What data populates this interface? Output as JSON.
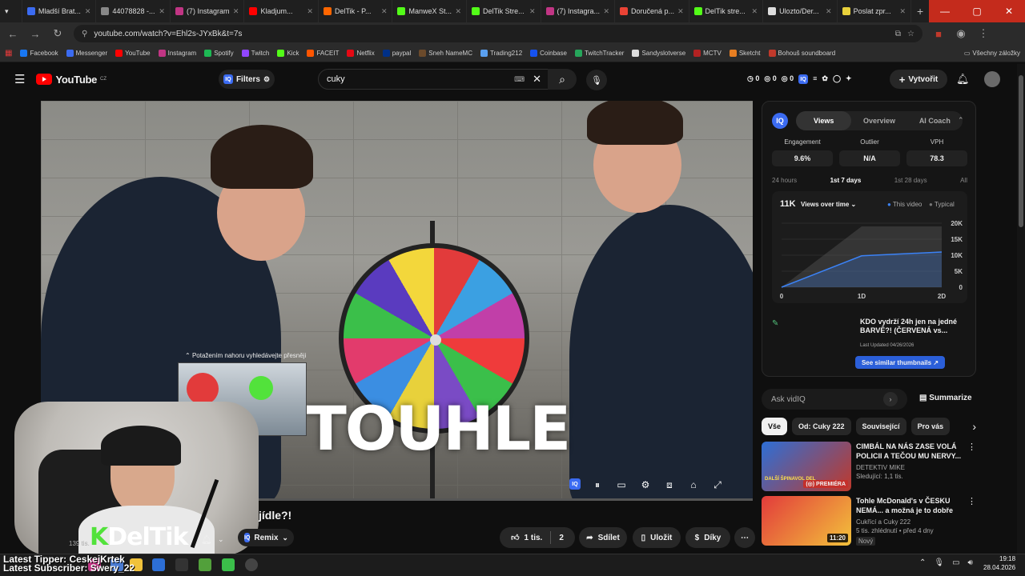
{
  "browser": {
    "tabs": [
      {
        "label": "",
        "color": "#c0392b"
      },
      {
        "label": "Mladší Brat...",
        "color": "#3b6bf1"
      },
      {
        "label": "44078828 -...",
        "color": "#888888"
      },
      {
        "label": "(7) Instagram",
        "color": "#c13584"
      },
      {
        "label": "Kladjum...",
        "color": "#ff0000"
      },
      {
        "label": "DelTik - P...",
        "color": "#ff6600"
      },
      {
        "label": "ManweX St...",
        "color": "#53fc18"
      },
      {
        "label": "DelTik Stre...",
        "color": "#53fc18"
      },
      {
        "label": "(7) Instagra...",
        "color": "#c13584"
      },
      {
        "label": "Doručená p...",
        "color": "#ea4335"
      },
      {
        "label": "DelTik stre...",
        "color": "#53fc18"
      },
      {
        "label": "Ulozto/Der...",
        "color": "#dddddd"
      },
      {
        "label": "Poslat zpr...",
        "color": "#e8d13b"
      }
    ],
    "url": "youtube.com/watch?v=Ehl2s-JYxBk&t=7s",
    "bookmarks": [
      {
        "label": "Facebook",
        "color": "#1877f2"
      },
      {
        "label": "Messenger",
        "color": "#3b6bf1"
      },
      {
        "label": "YouTube",
        "color": "#ff0000"
      },
      {
        "label": "Instagram",
        "color": "#c13584"
      },
      {
        "label": "Spotify",
        "color": "#1db954"
      },
      {
        "label": "Twitch",
        "color": "#9146ff"
      },
      {
        "label": "Kick",
        "color": "#53fc18"
      },
      {
        "label": "FACEIT",
        "color": "#ff5500"
      },
      {
        "label": "Netflix",
        "color": "#e50914"
      },
      {
        "label": "paypal",
        "color": "#003087"
      },
      {
        "label": "Sneh NameMC",
        "color": "#6b4a2b"
      },
      {
        "label": "Trading212",
        "color": "#5aa0f0"
      },
      {
        "label": "Coinbase",
        "color": "#1652f0"
      },
      {
        "label": "TwitchTracker",
        "color": "#26a65b"
      },
      {
        "label": "Sandyslotverse",
        "color": "#dddddd"
      },
      {
        "label": "MCTV",
        "color": "#b22222"
      },
      {
        "label": "Sketcht",
        "color": "#e67e22"
      },
      {
        "label": "Bohouš soundboard",
        "color": "#c0392b"
      }
    ],
    "all_bookmarks": "Všechny záložky"
  },
  "youtube": {
    "logo": "YouTube",
    "logo_region": "CZ",
    "filters_label": "Filters",
    "search_value": "cuky",
    "counters": [
      "0",
      "0",
      "0"
    ],
    "create_label": "Vytvořit"
  },
  "video": {
    "overlay_text": "TOUHLE",
    "title_partial": "jídle?!",
    "remix_label": "Remix",
    "hint": "Potažením nahoru vyhledávejte přesněji",
    "likes": "1 tis.",
    "dislikes": "2",
    "share": "Sdílet",
    "save": "Uložit",
    "thanks": "Díky",
    "subs": "139 tis."
  },
  "stream_overlay": {
    "brand_k": "K",
    "brand_rest": "DelTik",
    "latest_tipper": "Latest Tipper: CeskejKrtek",
    "latest_subscriber": "Latest Subscriber: Swery_22"
  },
  "vidiq": {
    "tabs": [
      "Views",
      "Overview",
      "AI Coach"
    ],
    "stats": [
      {
        "label": "Engagement",
        "value": "9.6%"
      },
      {
        "label": "Outlier",
        "value": "N/A"
      },
      {
        "label": "VPH",
        "value": "78.3"
      }
    ],
    "ranges": [
      "24 hours",
      "1st 7 days",
      "1st 28 days",
      "All"
    ],
    "total": "11K",
    "metric_select": "Views over time",
    "legend_this": "This video",
    "legend_typical": "Typical",
    "related_title": "KDO vydrží 24h jen na jedné BARVĚ?! (ČERVENÁ vs...",
    "last_updated": "Last Updated 04/26/2026",
    "see_similar": "See similar thumbnails",
    "ask_placeholder": "Ask vidIQ",
    "summarize": "Summarize"
  },
  "chart_data": {
    "type": "area",
    "x": [
      "0",
      "1D",
      "2D"
    ],
    "yticks": [
      "0",
      "5K",
      "10K",
      "15K",
      "20K"
    ],
    "ylim": [
      0,
      20000
    ],
    "series": [
      {
        "name": "This video",
        "values": [
          0,
          9800,
          11000
        ],
        "color": "#3b82f6"
      },
      {
        "name": "Typical",
        "values": [
          0,
          19000,
          19000
        ],
        "color": "#555555"
      }
    ]
  },
  "chips": [
    "Vše",
    "Od: Cuky 222",
    "Související",
    "Pro vás"
  ],
  "recommendations": [
    {
      "title": "CIMBÁL NA NÁS ZASE VOLÁ POLICII A TEČOU MU NERVY...",
      "channel": "DETEKTIV MIKE",
      "meta": "Sledující: 1,1 tis.",
      "badge": "PREMIÉRA",
      "thumb_text": "DALŠÍ ŠPINAVOL DEL",
      "color_a": "#2d6fd6",
      "color_b": "#c0392b"
    },
    {
      "title": "Tohle McDonald's v ČESKU NEMÁ... a možná je to dobře",
      "channel": "Cukřící a Cuky 222",
      "meta": "5 tis. zhlédnutí • před 4 dny",
      "badge": "Nový",
      "duration": "11:20",
      "color_a": "#e23b3b",
      "color_b": "#f3c23b"
    }
  ],
  "taskbar": {
    "time": "19:18",
    "date": "28.04.2026"
  }
}
